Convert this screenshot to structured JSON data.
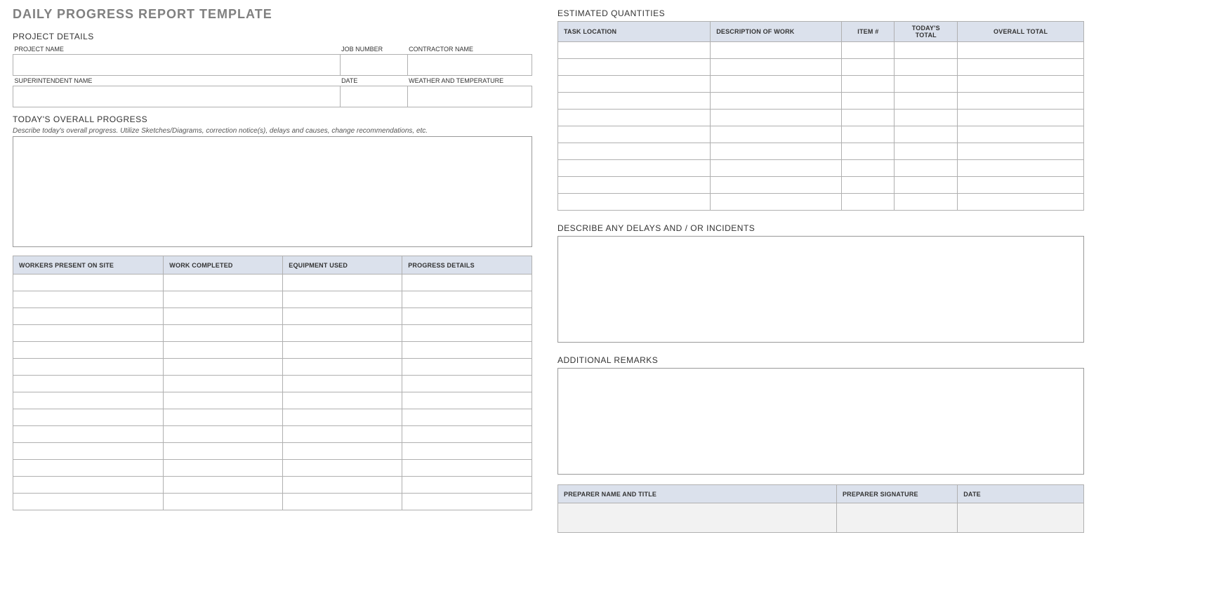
{
  "title": "DAILY PROGRESS REPORT TEMPLATE",
  "sections": {
    "project_details": "PROJECT DETAILS",
    "todays_progress": "TODAY'S OVERALL PROGRESS",
    "todays_progress_sub": "Describe today's overall progress.  Utilize Sketches/Diagrams, correction notice(s), delays and causes, change recommendations, etc.",
    "est_quantities": "ESTIMATED QUANTITIES",
    "delays": "DESCRIBE ANY DELAYS AND / OR INCIDENTS",
    "remarks": "ADDITIONAL REMARKS"
  },
  "project_details": {
    "labels": {
      "project_name": "PROJECT NAME",
      "job_number": "JOB NUMBER",
      "contractor_name": "CONTRACTOR NAME",
      "superintendent_name": "SUPERINTENDENT NAME",
      "date": "DATE",
      "weather": "WEATHER AND TEMPERATURE"
    },
    "values": {
      "project_name": "",
      "job_number": "",
      "contractor_name": "",
      "superintendent_name": "",
      "date": "",
      "weather": ""
    }
  },
  "progress_table": {
    "headers": {
      "workers": "WORKERS PRESENT ON SITE",
      "work_completed": "WORK COMPLETED",
      "equipment": "EQUIPMENT USED",
      "details": "PROGRESS DETAILS"
    },
    "rows": [
      {
        "workers": "",
        "work_completed": "",
        "equipment": "",
        "details": ""
      },
      {
        "workers": "",
        "work_completed": "",
        "equipment": "",
        "details": ""
      },
      {
        "workers": "",
        "work_completed": "",
        "equipment": "",
        "details": ""
      },
      {
        "workers": "",
        "work_completed": "",
        "equipment": "",
        "details": ""
      },
      {
        "workers": "",
        "work_completed": "",
        "equipment": "",
        "details": ""
      },
      {
        "workers": "",
        "work_completed": "",
        "equipment": "",
        "details": ""
      },
      {
        "workers": "",
        "work_completed": "",
        "equipment": "",
        "details": ""
      },
      {
        "workers": "",
        "work_completed": "",
        "equipment": "",
        "details": ""
      },
      {
        "workers": "",
        "work_completed": "",
        "equipment": "",
        "details": ""
      },
      {
        "workers": "",
        "work_completed": "",
        "equipment": "",
        "details": ""
      },
      {
        "workers": "",
        "work_completed": "",
        "equipment": "",
        "details": ""
      },
      {
        "workers": "",
        "work_completed": "",
        "equipment": "",
        "details": ""
      },
      {
        "workers": "",
        "work_completed": "",
        "equipment": "",
        "details": ""
      },
      {
        "workers": "",
        "work_completed": "",
        "equipment": "",
        "details": ""
      }
    ]
  },
  "quantities_table": {
    "headers": {
      "task_location": "TASK LOCATION",
      "desc": "DESCRIPTION OF WORK",
      "item": "ITEM #",
      "todays_total": "TODAY'S TOTAL",
      "overall_total": "OVERALL TOTAL"
    },
    "rows": [
      {
        "task_location": "",
        "desc": "",
        "item": "",
        "todays_total": "",
        "overall_total": ""
      },
      {
        "task_location": "",
        "desc": "",
        "item": "",
        "todays_total": "",
        "overall_total": ""
      },
      {
        "task_location": "",
        "desc": "",
        "item": "",
        "todays_total": "",
        "overall_total": ""
      },
      {
        "task_location": "",
        "desc": "",
        "item": "",
        "todays_total": "",
        "overall_total": ""
      },
      {
        "task_location": "",
        "desc": "",
        "item": "",
        "todays_total": "",
        "overall_total": ""
      },
      {
        "task_location": "",
        "desc": "",
        "item": "",
        "todays_total": "",
        "overall_total": ""
      },
      {
        "task_location": "",
        "desc": "",
        "item": "",
        "todays_total": "",
        "overall_total": ""
      },
      {
        "task_location": "",
        "desc": "",
        "item": "",
        "todays_total": "",
        "overall_total": ""
      },
      {
        "task_location": "",
        "desc": "",
        "item": "",
        "todays_total": "",
        "overall_total": ""
      },
      {
        "task_location": "",
        "desc": "",
        "item": "",
        "todays_total": "",
        "overall_total": ""
      }
    ]
  },
  "signature_table": {
    "headers": {
      "preparer_name": "PREPARER NAME AND TITLE",
      "preparer_sig": "PREPARER SIGNATURE",
      "date": "DATE"
    },
    "values": {
      "preparer_name": "",
      "preparer_sig": "",
      "date": ""
    }
  },
  "delays_text": "",
  "remarks_text": "",
  "overall_progress_text": ""
}
